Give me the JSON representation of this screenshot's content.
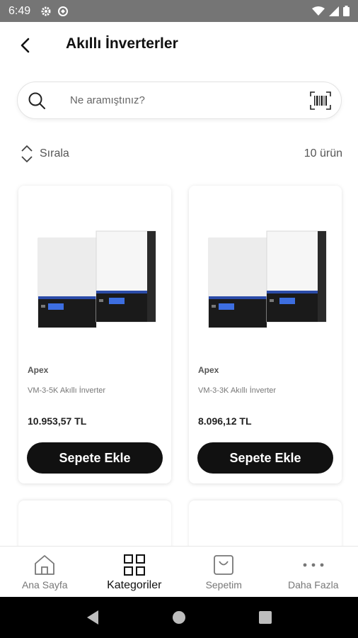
{
  "status_bar": {
    "time": "6:49"
  },
  "header": {
    "title": "Akıllı İnverterler"
  },
  "search": {
    "placeholder": "Ne aramıştınız?"
  },
  "sort": {
    "label": "Sırala",
    "count": "10 ürün"
  },
  "products": [
    {
      "brand": "Apex",
      "name": "VM-3-5K Akıllı İnverter",
      "price": "10.953,57 TL",
      "button": "Sepete Ekle"
    },
    {
      "brand": "Apex",
      "name": "VM-3-3K Akıllı İnverter",
      "price": "8.096,12 TL",
      "button": "Sepete Ekle"
    }
  ],
  "bottom_nav": {
    "items": [
      {
        "label": "Ana Sayfa",
        "icon": "home-icon",
        "active": false
      },
      {
        "label": "Kategoriler",
        "icon": "grid-icon",
        "active": true
      },
      {
        "label": "Sepetim",
        "icon": "bag-icon",
        "active": false
      },
      {
        "label": "Daha Fazla",
        "icon": "more-icon",
        "active": false
      }
    ]
  }
}
